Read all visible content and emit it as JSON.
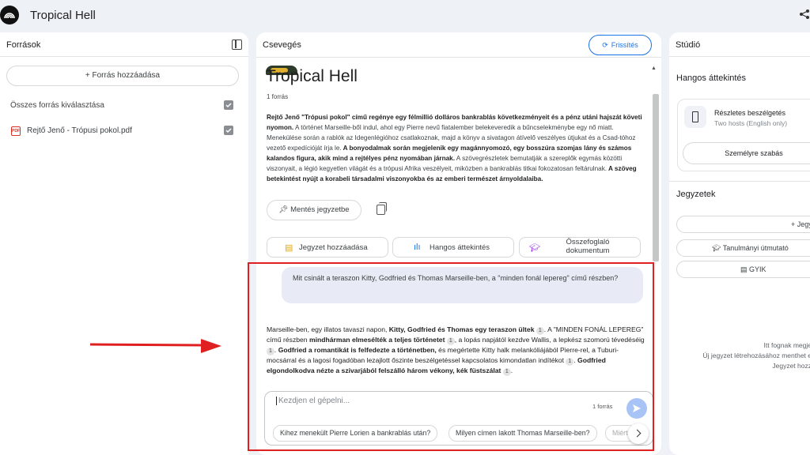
{
  "app": {
    "title": "Tropical Hell"
  },
  "sources_panel": {
    "title": "Források",
    "add_source_label": "Forrás hozzáadása",
    "select_all_label": "Összes forrás kiválasztása",
    "sources": [
      {
        "name": "Rejtő Jenő - Trópusi pokol.pdf",
        "type": "PDF",
        "checked": true
      }
    ]
  },
  "chat_panel": {
    "title": "Csevegés",
    "refresh_label": "Frissítés",
    "notebook_title": "Tropical Hell",
    "source_count": "1 forrás",
    "summary": {
      "s1": "Rejtő Jenő \"Trópusi pokol\" című regénye egy félmillió dolláros bankrablás következményeit és a pénz utáni hajszát követi nyomon.",
      "s2": " A történet Marseille-ből indul, ahol egy Pierre nevű fiatalember belekeveredik a bűncselekménybe egy nő miatt. Menekülése során a rablók az Idegenlégióhoz csatlakoznak, majd a könyv a sivatagon átívelő veszélyes útjukat és a Csad-tóhoz vezető expedícióját írja le.",
      "s3": " A bonyodalmak során megjelenik egy magánnyomozó, egy bosszúra szomjas lány és számos kalandos figura, akik mind a rejtélyes pénz nyomában járnak.",
      "s4": " A szövegrészletek bemutatják a szereplők egymás közötti viszonyait, a légió kegyetlen világát és a trópusi Afrika veszélyeit, miközben a bankrablás titkai fokozatosan feltárulnak.",
      "s5": " A szöveg betekintést nyújt a korabeli társadalmi viszonyokba és az emberi természet árnyoldalaiba."
    },
    "save_note_label": "Mentés jegyzetbe",
    "actions": {
      "add_note": "Jegyzet hozzáadása",
      "audio_overview": "Hangos áttekintés",
      "briefing_doc": "Összefoglaló dokumentum"
    },
    "user_question": "Mit csinált a teraszon Kitty, Godfried és Thomas Marseille-ben, a \"minden fonál lepereg\" című részben?",
    "answer": {
      "a1": "Marseille-ben, egy illatos tavaszi napon, ",
      "a2": "Kitty, Godfried és Thomas egy teraszon ültek",
      "a3": ". A \"MINDEN FONÁL LEPEREG\" című részben ",
      "a4": "mindhárman elmesélték a teljes történetet",
      "a5": ", a lopás napjától kezdve Wallis, a lepkész szomorú tévedéséig",
      "a6": ". ",
      "a7": "Godfried a romantikát is felfedezte a történetben,",
      "a8": " és megértette Kitty halk melankóliájából Pierre-rel, a Tuburi-mocsárral és a lagosi fogadóban lezajlott őszinte beszélgetéssel kapcsolatos kimondatlan indítékot",
      "a9": ". ",
      "a10": "Godfried elgondolkodva nézte a szivarjából felszálló három vékony, kék füstszálat",
      "a11": ".",
      "cite": "1"
    },
    "input_placeholder": "Kezdjen el gépelni...",
    "input_source_count": "1 forrás",
    "suggestions": [
      "Kihez menekült Pierre Lorien a bankrablás után?",
      "Milyen címen lakott Thomas Marseille-ben?",
      "Miért"
    ]
  },
  "studio_panel": {
    "title": "Stúdió",
    "audio_section_title": "Hangos áttekintés",
    "audio_card_title": "Részletes beszélgetés",
    "audio_card_subtitle": "Two hosts (English only)",
    "customize_label": "Személyre szabás",
    "notes_title": "Jegyzetek",
    "add_note_label": "Jegy",
    "study_guide_label": "Tanulmányi útmutató",
    "faq_label": "GYIK",
    "empty_line1": "Itt fognak megje",
    "empty_line2": "Új jegyzet létrehozásához menthet e",
    "empty_line3": "Jegyzet hozz"
  },
  "colors": {
    "accent": "#1a73e8",
    "annotation": "#e02020",
    "bubble": "#e8ebf5"
  }
}
